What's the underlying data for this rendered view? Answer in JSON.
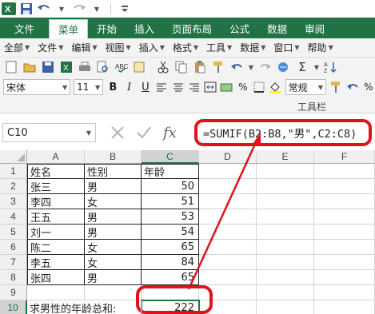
{
  "ribbon": {
    "tabs": [
      "文件",
      "菜单",
      "开始",
      "插入",
      "页面布局",
      "公式",
      "数据",
      "审阅"
    ],
    "active_tab": "菜单"
  },
  "menus": [
    "全部",
    "文件",
    "编辑",
    "视图",
    "插入",
    "格式",
    "工具",
    "数据",
    "窗口",
    "帮助"
  ],
  "toolbar": {
    "font_name": "宋体",
    "font_size": "11",
    "style_name": "常规",
    "label": "工具栏"
  },
  "formula_bar": {
    "name_box": "C10",
    "formula": "=SUMIF(B2:B8,\"男\",C2:C8)",
    "fx": "fx"
  },
  "grid": {
    "columns": [
      "A",
      "B",
      "C",
      "D",
      "E",
      "F"
    ],
    "rows": [
      "1",
      "2",
      "3",
      "4",
      "5",
      "6",
      "7",
      "8",
      "9",
      "10"
    ],
    "header_row": {
      "a": "姓名",
      "b": "性别",
      "c": "年龄"
    },
    "data_rows": [
      {
        "a": "张三",
        "b": "男",
        "c": "50"
      },
      {
        "a": "李四",
        "b": "女",
        "c": "51"
      },
      {
        "a": "王五",
        "b": "男",
        "c": "53"
      },
      {
        "a": "刘一",
        "b": "男",
        "c": "54"
      },
      {
        "a": "陈二",
        "b": "女",
        "c": "65"
      },
      {
        "a": "李五",
        "b": "女",
        "c": "84"
      },
      {
        "a": "张四",
        "b": "男",
        "c": "65"
      }
    ],
    "row10_label": "求男性的年龄总和:",
    "row10_value": "222"
  },
  "colors": {
    "excel_green": "#217346",
    "highlight_red": "#e0121a"
  }
}
